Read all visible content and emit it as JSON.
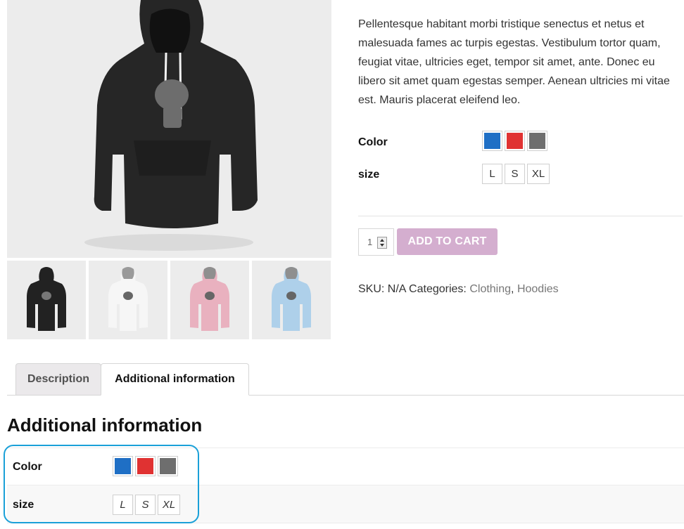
{
  "gallery": {
    "main_alt": "hoodie-black",
    "thumbnails": [
      {
        "name": "thumb-black",
        "color": "#2e2e2e"
      },
      {
        "name": "thumb-white",
        "color": "#f3f3f3"
      },
      {
        "name": "thumb-pink",
        "color": "#e6a9b8"
      },
      {
        "name": "thumb-blue",
        "color": "#a9cde6"
      }
    ]
  },
  "product": {
    "description": "Pellentesque habitant morbi tristique senectus et netus et malesuada fames ac turpis egestas. Vestibulum tortor quam, feugiat vitae, ultricies eget, tempor sit amet, ante. Donec eu libero sit amet quam egestas semper. Aenean ultricies mi vitae est. Mauris placerat eleifend leo.",
    "variations": {
      "color_label": "Color",
      "color_swatches": [
        {
          "name": "Blue",
          "hex": "#1f6fc5"
        },
        {
          "name": "Red",
          "hex": "#e03232"
        },
        {
          "name": "Gray",
          "hex": "#6e6e6e"
        }
      ],
      "size_label": "size",
      "sizes": [
        "L",
        "S",
        "XL"
      ]
    },
    "quantity": "1",
    "add_to_cart_label": "ADD TO CART",
    "meta": {
      "sku_label": "SKU:",
      "sku_value": "N/A",
      "categories_label": "Categories:",
      "category_1": "Clothing",
      "separator": ",",
      "category_2": "Hoodies"
    }
  },
  "tabs": [
    {
      "label": "Description",
      "active": false
    },
    {
      "label": "Additional information",
      "active": true
    }
  ],
  "additional_info": {
    "title": "Additional information",
    "rows": [
      {
        "label": "Color"
      },
      {
        "label": "size",
        "values": [
          "L",
          "S",
          "XL"
        ]
      }
    ]
  },
  "colors": {
    "add_to_cart_bg": "#d4aecf",
    "highlight_border": "#1aa0d8",
    "link": "#777777"
  }
}
